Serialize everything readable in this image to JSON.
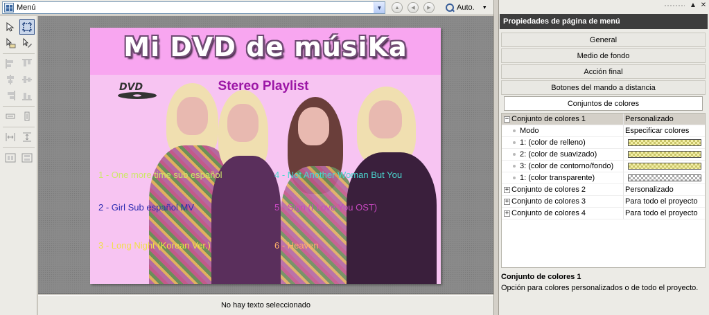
{
  "toolbar": {
    "menu_select_value": "Menú",
    "zoom_label": "Auto."
  },
  "canvas": {
    "title": "Mi DVD de músiKa",
    "subtitle": "Stereo Playlist",
    "tracks": [
      "1 - One more time sub español",
      "2 - Girl Sub español MV",
      "3 - Long Night (Korean Ver.)",
      "4 - Not Another Woman But You",
      "5 - Sign (I Love You OST)",
      "6 - Heaven"
    ],
    "track_colors": [
      "#cde86a",
      "#2a2ab0",
      "#f0e04a",
      "#4ad8d0",
      "#c848c0",
      "#ffb06a"
    ]
  },
  "status": "No hay texto seleccionado",
  "panel": {
    "title": "Propiedades de página de menú",
    "buttons": [
      "General",
      "Medio de fondo",
      "Acción final",
      "Botones del mando a distancia",
      "Conjuntos de colores"
    ],
    "selected_button": "Conjuntos de colores",
    "rows": [
      {
        "name": "Conjunto de colores 1",
        "value": "Personalizado"
      },
      {
        "name": "Modo",
        "value": "Especificar colores"
      },
      {
        "name": "1: (color de relleno)",
        "value": ""
      },
      {
        "name": "2: (color de suavizado)",
        "value": ""
      },
      {
        "name": "3: (color de contorno/fondo)",
        "value": ""
      },
      {
        "name": "1: (color transparente)",
        "value": ""
      },
      {
        "name": "Conjunto de colores 2",
        "value": "Personalizado"
      },
      {
        "name": "Conjunto de colores 3",
        "value": "Para todo el proyecto"
      },
      {
        "name": "Conjunto de colores 4",
        "value": "Para todo el proyecto"
      }
    ],
    "description_title": "Conjunto de colores 1",
    "description_text": "Opción para colores personalizados o de todo el proyecto."
  },
  "icons": [
    "menu-page-icon",
    "dropdown-arrow-icon",
    "nav-up-icon",
    "nav-back-icon",
    "nav-forward-icon",
    "magnifier-icon",
    "arrow-pointer-icon",
    "crop-select-icon",
    "move-tool-icon",
    "dvd-logo-icon",
    "close-icon"
  ]
}
